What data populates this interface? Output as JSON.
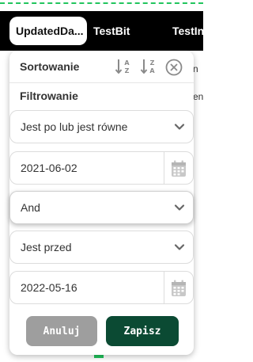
{
  "header": {
    "tabs": [
      {
        "label": "UpdatedDa..."
      },
      {
        "label": "TestBit"
      },
      {
        "label": "TestIn"
      }
    ]
  },
  "background": {
    "peek_text_1": "n",
    "peek_text_2": "en"
  },
  "popup": {
    "sort_label": "Sortowanie",
    "filter_label": "Filtrowanie",
    "filter1": {
      "operator": "Jest po lub jest równe",
      "date_value": "2021-06-02"
    },
    "logic_operator": "And",
    "filter2": {
      "operator": "Jest przed",
      "date_value": "2022-05-16"
    },
    "buttons": {
      "cancel": "Anuluj",
      "save": "Zapisz"
    }
  },
  "colors": {
    "accent_green": "#22c55e",
    "save_button": "#0b4a33",
    "cancel_button": "#9e9e9e"
  },
  "icons": [
    "sort-ascending-icon",
    "sort-descending-icon",
    "close-icon",
    "chevron-down-icon",
    "calendar-icon"
  ]
}
